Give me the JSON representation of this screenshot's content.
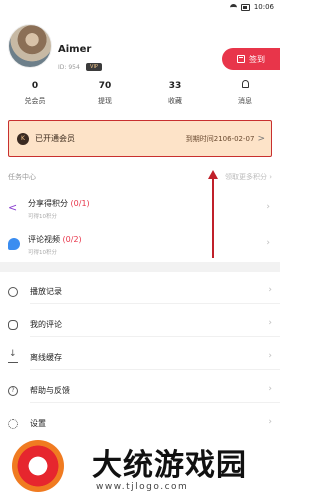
{
  "status_bar": {
    "time": "10:06"
  },
  "profile": {
    "username": "Aimer",
    "user_id": "ID: 954",
    "vip_badge": "VIP",
    "signin_label": "签到"
  },
  "stats": [
    {
      "value": "0",
      "label": "兑会员"
    },
    {
      "value": "70",
      "label": "提现"
    },
    {
      "value": "33",
      "label": "收藏"
    },
    {
      "value": "",
      "label": "消息"
    }
  ],
  "membership": {
    "icon_text": "K",
    "status": "已开通会员",
    "expiry": "到期时间2106-02-07",
    "chevron": ">"
  },
  "tasks": {
    "header": "任务中心",
    "more_link": "领取更多积分",
    "items": [
      {
        "title": "分享得积分",
        "progress": "(0/1)",
        "sub": "可得10积分",
        "icon": "share-icon"
      },
      {
        "title": "评论视频",
        "progress": "(0/2)",
        "sub": "可得10积分",
        "icon": "comment-video-icon"
      }
    ]
  },
  "menu": [
    {
      "label": "播放记录",
      "icon": "history-icon"
    },
    {
      "label": "我的评论",
      "icon": "comment-icon"
    },
    {
      "label": "离线缓存",
      "icon": "download-icon"
    },
    {
      "label": "帮助与反馈",
      "icon": "help-icon"
    },
    {
      "label": "设置",
      "icon": "settings-icon"
    }
  ],
  "watermark": {
    "title": "大统游戏园",
    "url": "www.tjlogo.com"
  },
  "colors": {
    "accent": "#e8354a",
    "member_bg": "#fde3c8",
    "annotation_red": "#c0202a"
  }
}
